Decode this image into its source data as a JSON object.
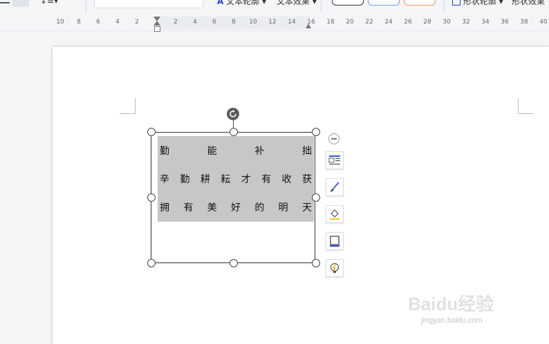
{
  "toolbar": {
    "text_outline": "文本轮廓",
    "text_effect": "文本效果",
    "shape_outline": "形状轮廓",
    "shape_effect": "形状效果"
  },
  "ruler": {
    "ticks": [
      "10",
      "8",
      "6",
      "4",
      "2",
      "2",
      "4",
      "6",
      "8",
      "10",
      "12",
      "14",
      "16",
      "18",
      "20",
      "22",
      "24",
      "26",
      "28",
      "30",
      "32",
      "34",
      "36",
      "38",
      "40"
    ]
  },
  "textbox": {
    "lines": [
      [
        "勤",
        "能",
        "补",
        "拙"
      ],
      [
        "辛",
        "勤",
        "耕",
        "耘",
        "才",
        "有",
        "收",
        "获"
      ],
      [
        "拥",
        "有",
        "美",
        "好",
        "的",
        "明",
        "天"
      ]
    ]
  },
  "float_toolbar": {
    "icons": [
      "layout-options-icon",
      "brush-icon",
      "fill-icon",
      "border-icon",
      "smart-tip-icon"
    ]
  },
  "watermark": {
    "brand": "Baidu经验",
    "url": "jingyan.baidu.com"
  }
}
